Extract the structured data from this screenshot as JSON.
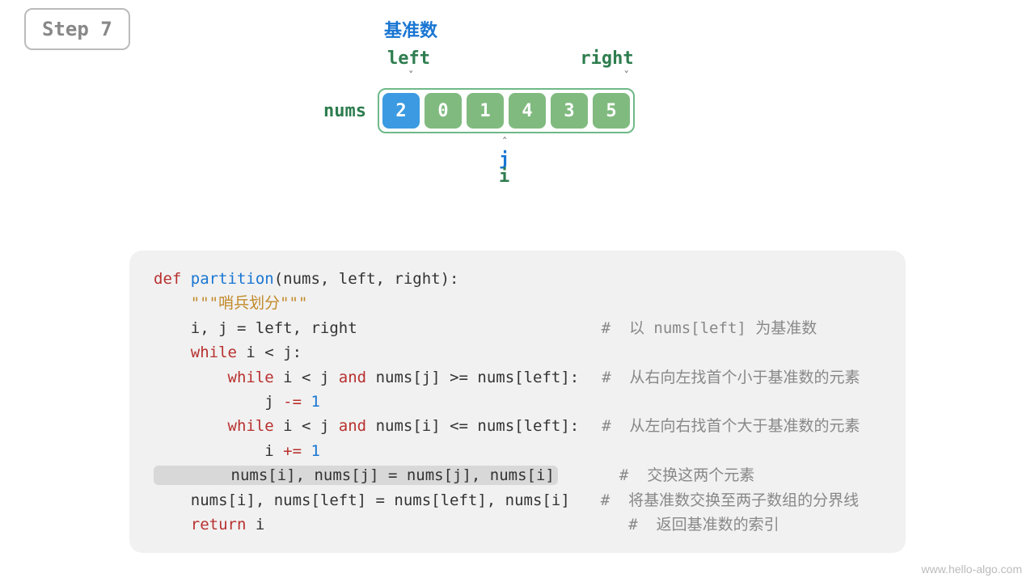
{
  "step_label": "Step 7",
  "pivot_label": "基准数",
  "left_label": "left",
  "right_label": "right",
  "nums_label": "nums",
  "array": [
    "2",
    "0",
    "1",
    "4",
    "3",
    "5"
  ],
  "pivot_index": 0,
  "j_label": "j",
  "i_label": "i",
  "code": {
    "l1_def": "def ",
    "l1_fn": "partition",
    "l1_rest": "(nums, left, right):",
    "l2": "    \"\"\"哨兵划分\"\"\"",
    "l3": "    i, j = left, right",
    "l3c": "#  以 nums[left] 为基准数",
    "l4a": "    ",
    "l4kw": "while",
    "l4b": " i < j:",
    "l5a": "        ",
    "l5kw": "while",
    "l5b": " i < j ",
    "l5and": "and",
    "l5c": " nums[j] >= nums[left]:",
    "l5cm": "#  从右向左找首个小于基准数的元素",
    "l6a": "            j ",
    "l6op": "-=",
    "l6n": " 1",
    "l7a": "        ",
    "l7kw": "while",
    "l7b": " i < j ",
    "l7and": "and",
    "l7c": " nums[i] <= nums[left]:",
    "l7cm": "#  从左向右找首个大于基准数的元素",
    "l8a": "            i ",
    "l8op": "+=",
    "l8n": " 1",
    "l9": "        nums[i], nums[j] = nums[j], nums[i]",
    "l9cm": "#  交换这两个元素",
    "l10": "    nums[i], nums[left] = nums[left], nums[i]",
    "l10cm": "#  将基准数交换至两子数组的分界线",
    "l11a": "    ",
    "l11kw": "return",
    "l11b": " i",
    "l11cm": "#  返回基准数的索引"
  },
  "watermark": "www.hello-algo.com"
}
